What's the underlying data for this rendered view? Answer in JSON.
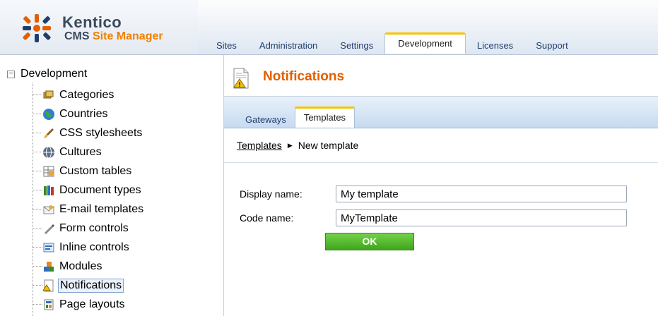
{
  "brand": {
    "name": "Kentico",
    "sub_prefix": "CMS ",
    "sub_accent": "Site Manager"
  },
  "top_tabs": [
    {
      "label": "Sites"
    },
    {
      "label": "Administration"
    },
    {
      "label": "Settings"
    },
    {
      "label": "Development",
      "active": true
    },
    {
      "label": "Licenses"
    },
    {
      "label": "Support"
    }
  ],
  "tree": {
    "root": {
      "expander": "−",
      "label": "Development"
    },
    "items": [
      {
        "label": "Categories",
        "icon": "categories-icon"
      },
      {
        "label": "Countries",
        "icon": "globe-icon"
      },
      {
        "label": "CSS stylesheets",
        "icon": "brush-icon"
      },
      {
        "label": "Cultures",
        "icon": "culture-globe-icon"
      },
      {
        "label": "Custom tables",
        "icon": "table-icon"
      },
      {
        "label": "Document types",
        "icon": "document-types-icon"
      },
      {
        "label": "E-mail templates",
        "icon": "email-icon"
      },
      {
        "label": "Form controls",
        "icon": "form-control-icon"
      },
      {
        "label": "Inline controls",
        "icon": "inline-control-icon"
      },
      {
        "label": "Modules",
        "icon": "modules-icon"
      },
      {
        "label": "Notifications",
        "icon": "notification-icon",
        "selected": true
      },
      {
        "label": "Page layouts",
        "icon": "page-layout-icon"
      }
    ]
  },
  "main": {
    "title": "Notifications",
    "sub_tabs": [
      {
        "label": "Gateways"
      },
      {
        "label": "Templates",
        "active": true
      }
    ],
    "breadcrumb": {
      "link": "Templates",
      "separator": "▶",
      "current": "New template"
    },
    "form": {
      "display_name_label": "Display name:",
      "display_name_value": "My template",
      "code_name_label": "Code name:",
      "code_name_value": "MyTemplate",
      "ok_label": "OK"
    }
  },
  "colors": {
    "accent_orange": "#e35f00",
    "tab_highlight": "#f7c400",
    "ok_green": "#4cb526",
    "link_blue": "#1e3e6e"
  }
}
